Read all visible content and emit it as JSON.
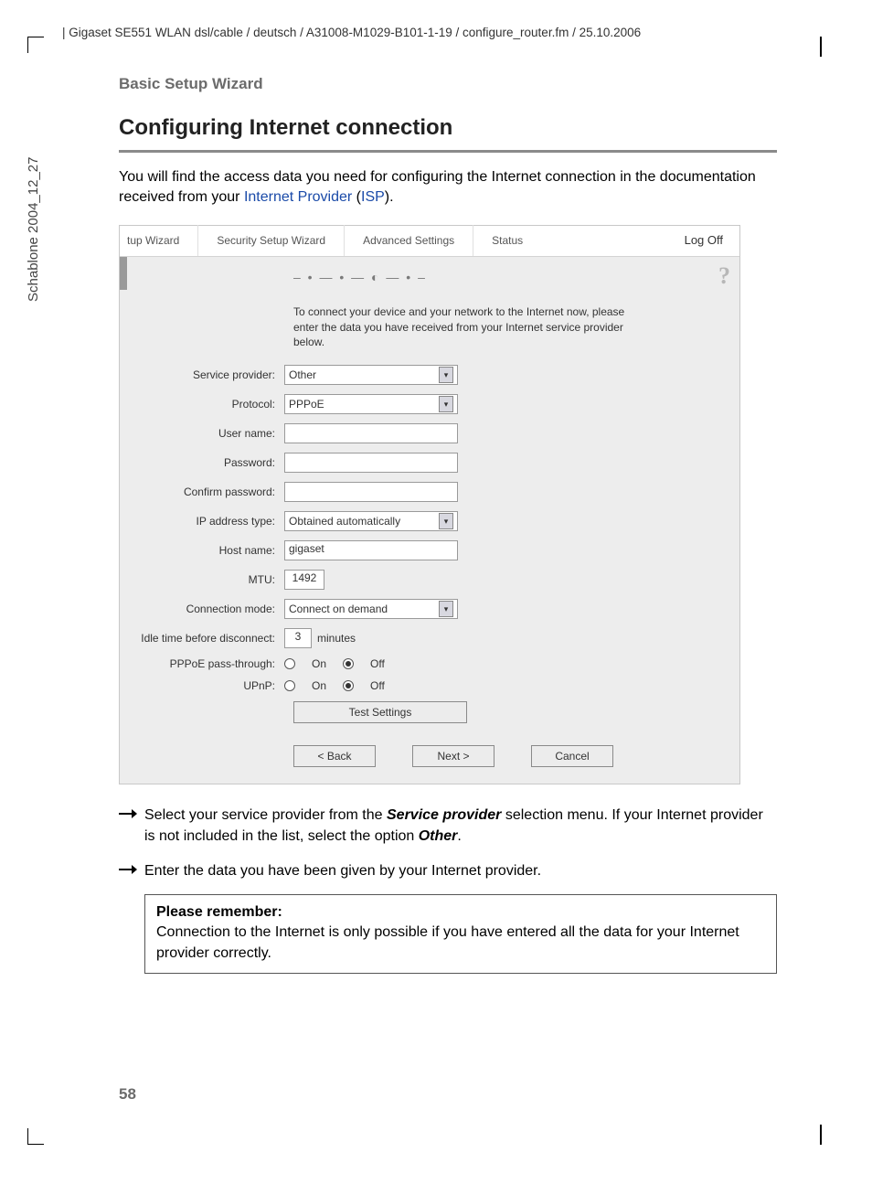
{
  "header": "| Gigaset SE551 WLAN dsl/cable / deutsch / A31008-M1029-B101-1-19 / configure_router.fm / 25.10.2006",
  "sidetext": "Schablone 2004_12_27",
  "section_label": "Basic Setup Wizard",
  "title": "Configuring Internet connection",
  "intro": {
    "pre": "You will find the access data you need for configuring the Internet connection in the documentation received from your ",
    "link1": "Internet Provider",
    "mid": " (",
    "link2": "ISP",
    "end": ")."
  },
  "tabs": [
    "tup Wizard",
    "Security Setup Wizard",
    "Advanced Settings",
    "Status"
  ],
  "logoff": "Log Off",
  "progress": "– • — • — ◐ — • –",
  "wiz_desc": "To connect your device and your network to the Internet now, please enter the data you have received from your Internet service provider below.",
  "fields": {
    "service_provider": {
      "label": "Service provider:",
      "value": "Other"
    },
    "protocol": {
      "label": "Protocol:",
      "value": "PPPoE"
    },
    "username": {
      "label": "User name:",
      "value": ""
    },
    "password": {
      "label": "Password:",
      "value": ""
    },
    "confirm_password": {
      "label": "Confirm password:",
      "value": ""
    },
    "ip_address_type": {
      "label": "IP address type:",
      "value": "Obtained automatically"
    },
    "host_name": {
      "label": "Host name:",
      "value": "gigaset"
    },
    "mtu": {
      "label": "MTU:",
      "value": "1492"
    },
    "connection_mode": {
      "label": "Connection mode:",
      "value": "Connect on demand"
    },
    "idle_time": {
      "label": "Idle time before disconnect:",
      "value": "3",
      "unit": "minutes"
    },
    "pppoe": {
      "label": "PPPoE pass-through:",
      "on": "On",
      "off": "Off",
      "selected": "Off"
    },
    "upnp": {
      "label": "UPnP:",
      "on": "On",
      "off": "Off",
      "selected": "Off"
    }
  },
  "buttons": {
    "test": "Test Settings",
    "back": "< Back",
    "next": "Next >",
    "cancel": "Cancel"
  },
  "bullets": {
    "b1_pre": "Select your service provider from the ",
    "b1_em": "Service provider",
    "b1_mid": " selection menu. If your Internet provider is not included in the list, select the option ",
    "b1_em2": "Other",
    "b1_end": ".",
    "b2": "Enter the data you have been given by your Internet provider."
  },
  "note": {
    "title": "Please remember:",
    "body": "Connection to the Internet is only possible if you have entered all the data for your Internet provider correctly."
  },
  "page_num": "58"
}
